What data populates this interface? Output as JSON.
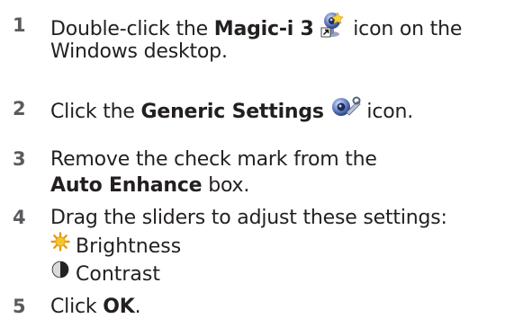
{
  "steps": [
    {
      "number": "1",
      "pre": "Double-click the ",
      "bold": "Magic-i 3",
      "icon": "webcam-shortcut-icon",
      "post_line1": " icon on the",
      "line2": "Windows desktop."
    },
    {
      "number": "2",
      "pre": "Click the ",
      "bold": "Generic Settings",
      "icon": "generic-settings-icon",
      "post": " icon."
    },
    {
      "number": "3",
      "line1": "Remove the check mark from the",
      "bold": "Auto Enhance",
      "post": " box."
    },
    {
      "number": "4",
      "line1": "Drag the sliders to adjust these settings:",
      "items": [
        {
          "icon": "brightness-sun-icon",
          "label": "Brightness"
        },
        {
          "icon": "contrast-circle-icon",
          "label": "Contrast"
        }
      ]
    },
    {
      "number": "5",
      "pre": "Click ",
      "bold": "OK",
      "post": "."
    }
  ]
}
